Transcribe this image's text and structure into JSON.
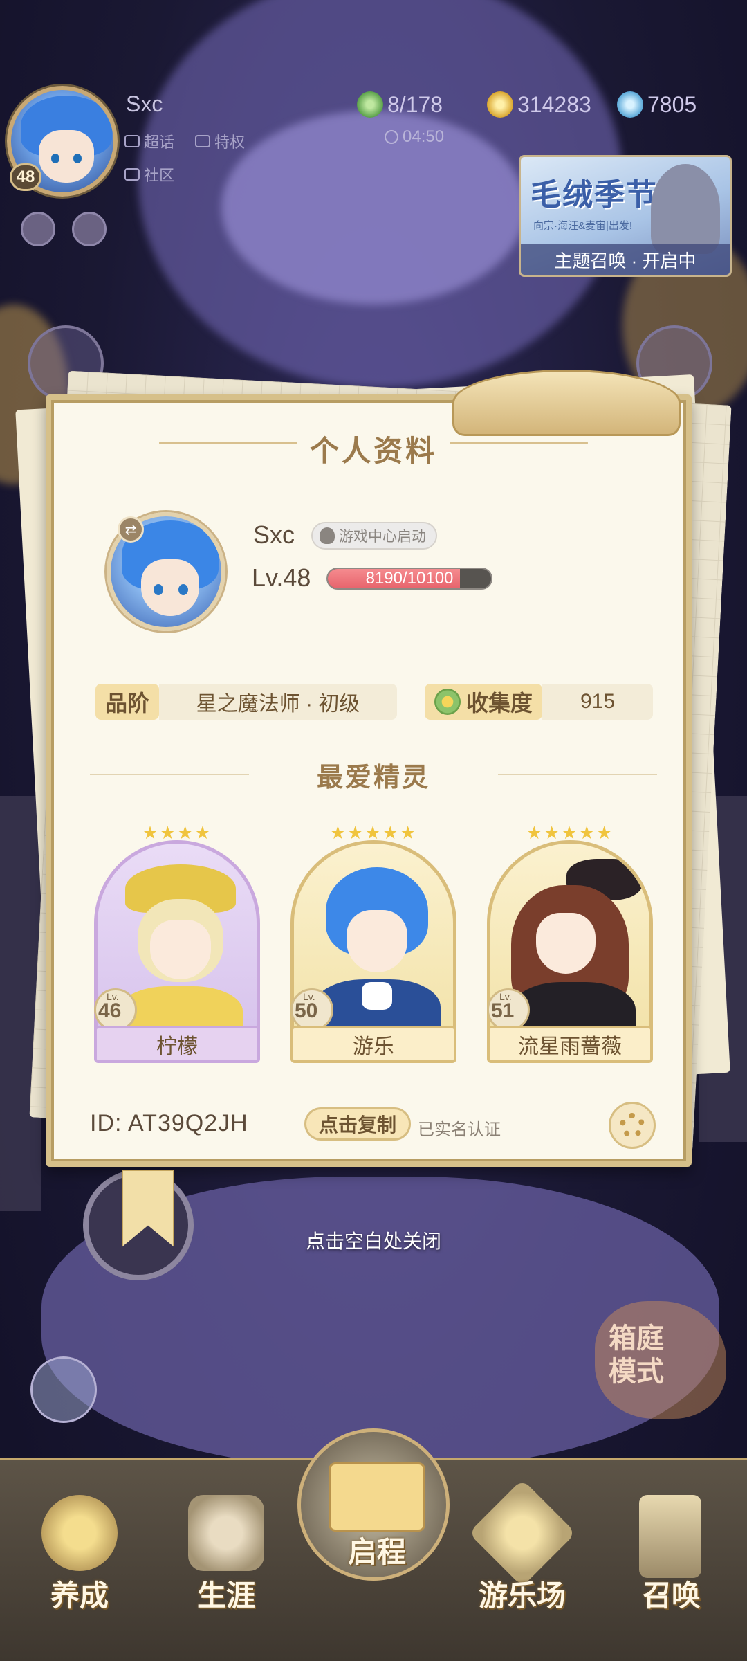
{
  "hud": {
    "player_name": "Sxc",
    "level": "48",
    "tag_super": "超话",
    "tag_privilege": "特权",
    "tag_community": "社区",
    "energy": "8/178",
    "gold": "314283",
    "gems": "7805",
    "timer": "04:50"
  },
  "banner": {
    "title": "毛绒季节",
    "subtitle": "向宗·海汪&麦宙|出发!",
    "footer": "主题召唤 · 开启中"
  },
  "card": {
    "title": "个人资料",
    "name": "Sxc",
    "login_chip": "游戏中心启动",
    "level_label": "Lv.48",
    "xp_text": "8190/10100",
    "xp_current": 8190,
    "xp_max": 10100,
    "rank_label": "品阶",
    "rank_value": "星之魔法师 · 初级",
    "collection_label": "收集度",
    "collection_value": "915",
    "favorites_title": "最爱精灵",
    "spirits": [
      {
        "name": "柠檬",
        "level": "46",
        "stars": "★★★★",
        "lv_prefix": "Lv."
      },
      {
        "name": "游乐",
        "level": "50",
        "stars": "★★★★★",
        "lv_prefix": "Lv."
      },
      {
        "name": "流星雨蔷薇",
        "level": "51",
        "stars": "★★★★★",
        "lv_prefix": "Lv."
      }
    ],
    "id_text": "ID:  AT39Q2JH",
    "copy_button": "点击复制",
    "realname": "已实名认证"
  },
  "close_hint": "点击空白处关闭",
  "mode_button": "箱庭\n模式",
  "nav": {
    "items": [
      "养成",
      "生涯",
      "启程",
      "游乐场",
      "召唤"
    ]
  },
  "colors": {
    "gold_accent": "#d6c08a",
    "xp_fill": "#e7646c",
    "purple_frame": "#c9a8de"
  }
}
